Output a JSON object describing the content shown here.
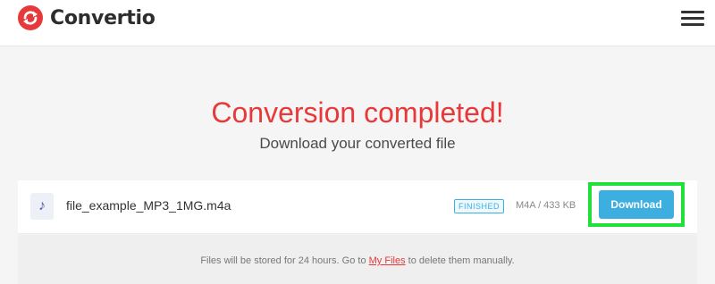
{
  "app": {
    "logo_text": "Convertio",
    "brand_color": "#e8393a",
    "accent_color": "#3daee0",
    "icons": {
      "logo": "convertio-logo-icon",
      "menu": "hamburger-menu-icon",
      "file": "music-note-icon"
    }
  },
  "main": {
    "title": "Conversion completed!",
    "subtitle": "Download your converted file"
  },
  "file": {
    "name": "file_example_MP3_1MG.m4a",
    "status": "FINISHED",
    "format_size": "M4A / 433 KB",
    "download_label": "Download",
    "icon_glyph": "♪"
  },
  "note": {
    "prefix": "Files will be stored for 24 hours. Go to ",
    "link_label": "My Files",
    "suffix": " to delete them manually."
  }
}
